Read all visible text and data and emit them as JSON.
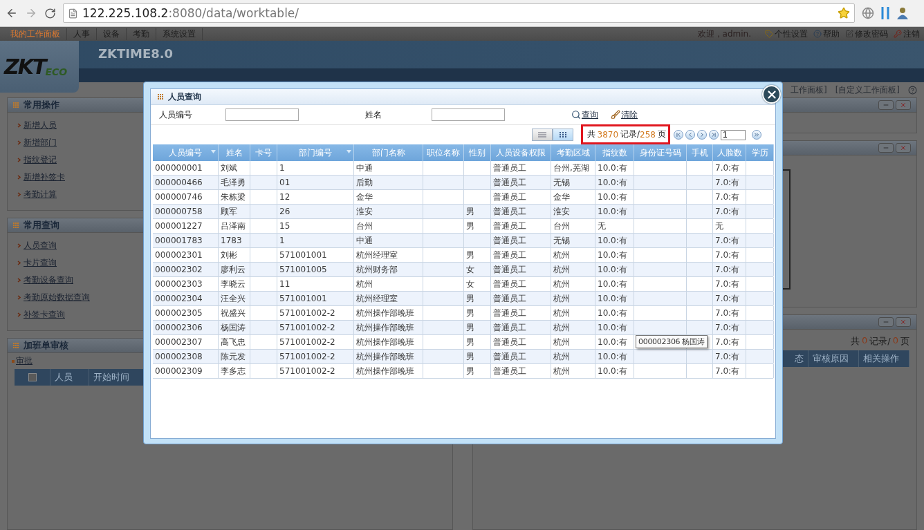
{
  "browser": {
    "url_host": "122.225.108.2",
    "url_path": ":8080/data/worktable/"
  },
  "nav": {
    "items": [
      {
        "label": "我的工作面板",
        "selected": true
      },
      {
        "label": "人事",
        "selected": false
      },
      {
        "label": "设备",
        "selected": false
      },
      {
        "label": "考勤",
        "selected": false
      },
      {
        "label": "系统设置",
        "selected": false
      }
    ],
    "welcome": "欢迎，admin.",
    "links": [
      {
        "label": "个性设置",
        "kind": "personal"
      },
      {
        "label": "帮助",
        "kind": "help"
      },
      {
        "label": "修改密码",
        "kind": "password"
      },
      {
        "label": "注销",
        "kind": "logout"
      }
    ]
  },
  "banner": {
    "logo_main": "ZKT",
    "logo_sub": "ECO",
    "product": "ZKTIME8.0"
  },
  "workspace_links": [
    "工作面板]",
    "[自定义工作面板]"
  ],
  "left_panels": [
    {
      "title": "常用操作",
      "items": [
        "新增人员",
        "新增部门",
        "指纹登记",
        "新增补签卡",
        "考勤计算"
      ]
    },
    {
      "title": "常用查询",
      "items": [
        "人员查询",
        "卡片查询",
        "考勤设备查询",
        "考勤原始数据查询",
        "补签卡查询"
      ]
    }
  ],
  "approval_panel": {
    "title": "加班单审核",
    "link": "审批",
    "checked": false,
    "columns": [
      "人员",
      "开始时间"
    ]
  },
  "right_panels": [
    {
      "kind": "empty"
    },
    {
      "kind": "box"
    },
    {
      "kind": "list",
      "summary": {
        "prefix": "共",
        "count": "0",
        "mid": "记录/",
        "pages": "0",
        "suffix": "页"
      },
      "columns": [
        "态",
        "审核原因",
        "相关操作"
      ]
    }
  ],
  "dialog": {
    "title": "人员查询",
    "fields": [
      {
        "label": "人员编号"
      },
      {
        "label": "姓名"
      }
    ],
    "actions": [
      {
        "label": "查询",
        "kind": "search"
      },
      {
        "label": "清除",
        "kind": "clear"
      }
    ],
    "views": [
      {
        "kind": "list",
        "selected": false
      },
      {
        "kind": "grid",
        "selected": true
      }
    ],
    "pager": {
      "prefix": "共",
      "records": "3870",
      "records_label": "记录/",
      "pages": "258",
      "pages_label": "页",
      "page": "1",
      "highlighted": true
    },
    "table": {
      "columns": [
        {
          "label": "人员编号",
          "sortable": true
        },
        {
          "label": "姓名",
          "sortable": false
        },
        {
          "label": "卡号",
          "sortable": false
        },
        {
          "label": "部门编号",
          "sortable": true
        },
        {
          "label": "部门名称",
          "sortable": false
        },
        {
          "label": "职位名称",
          "sortable": false
        },
        {
          "label": "性别",
          "sortable": false
        },
        {
          "label": "人员设备权限",
          "sortable": false
        },
        {
          "label": "考勤区域",
          "sortable": false
        },
        {
          "label": "指纹数",
          "sortable": false
        },
        {
          "label": "身份证号码",
          "sortable": false
        },
        {
          "label": "手机",
          "sortable": false
        },
        {
          "label": "人脸数",
          "sortable": false
        },
        {
          "label": "学历",
          "sortable": false
        }
      ],
      "rows": [
        [
          "000000001",
          "刘斌",
          "",
          "1",
          "中通",
          "",
          "",
          "普通员工",
          "台州,芜湖",
          "10.0:有",
          "",
          "",
          "7.0:有",
          ""
        ],
        [
          "000000466",
          "毛泽勇",
          "",
          "01",
          "后勤",
          "",
          "",
          "普通员工",
          "无锡",
          "10.0:有",
          "",
          "",
          "7.0:有",
          ""
        ],
        [
          "000000746",
          "朱栋梁",
          "",
          "12",
          "金华",
          "",
          "",
          "普通员工",
          "金华",
          "10.0:有",
          "",
          "",
          "7.0:有",
          ""
        ],
        [
          "000000758",
          "顾军",
          "",
          "26",
          "淮安",
          "",
          "男",
          "普通员工",
          "淮安",
          "10.0:有",
          "",
          "",
          "7.0:有",
          ""
        ],
        [
          "000001227",
          "吕泽南",
          "",
          "15",
          "台州",
          "",
          "男",
          "普通员工",
          "台州",
          "无",
          "",
          "",
          "无",
          ""
        ],
        [
          "000001783",
          "1783",
          "",
          "1",
          "中通",
          "",
          "",
          "普通员工",
          "无锡",
          "10.0:有",
          "",
          "",
          "7.0:有",
          ""
        ],
        [
          "000002301",
          "刘彬",
          "",
          "571001001",
          "杭州经理室",
          "",
          "男",
          "普通员工",
          "杭州",
          "10.0:有",
          "",
          "",
          "7.0:有",
          ""
        ],
        [
          "000002302",
          "廖利云",
          "",
          "571001005",
          "杭州财务部",
          "",
          "女",
          "普通员工",
          "杭州",
          "10.0:有",
          "",
          "",
          "7.0:有",
          ""
        ],
        [
          "000002303",
          "李晓云",
          "",
          "11",
          "杭州",
          "",
          "女",
          "普通员工",
          "杭州",
          "10.0:有",
          "",
          "",
          "7.0:有",
          ""
        ],
        [
          "000002304",
          "汪全兴",
          "",
          "571001001",
          "杭州经理室",
          "",
          "男",
          "普通员工",
          "杭州",
          "10.0:有",
          "",
          "",
          "7.0:有",
          ""
        ],
        [
          "000002305",
          "祝盛兴",
          "",
          "571001002-2",
          "杭州操作部晚班",
          "",
          "男",
          "普通员工",
          "杭州",
          "10.0:有",
          "",
          "",
          "7.0:有",
          ""
        ],
        [
          "000002306",
          "杨国涛",
          "",
          "571001002-2",
          "杭州操作部晚班",
          "",
          "男",
          "普通员工",
          "杭州",
          "10.0:有",
          "",
          "",
          "7.0:有",
          ""
        ],
        {
          "cells": [
            "000002307",
            "高飞忠",
            "",
            "571001002-2",
            "杭州操作部晚班",
            "",
            "男",
            "普通员工",
            "杭州",
            "10.0:有",
            "",
            "",
            "7.0:有",
            ""
          ],
          "tooltip": "000002306 杨国涛"
        },
        [
          "000002308",
          "陈元发",
          "",
          "571001002-2",
          "杭州操作部晚班",
          "",
          "男",
          "普通员工",
          "杭州",
          "10.0:有",
          "",
          "",
          "7.0:有",
          ""
        ],
        [
          "000002309",
          "李多志",
          "",
          "571001002-2",
          "杭州操作部晚班",
          "",
          "男",
          "普通员工",
          "杭州",
          "10.0:有",
          "",
          "",
          "7.0:有",
          ""
        ]
      ]
    }
  }
}
